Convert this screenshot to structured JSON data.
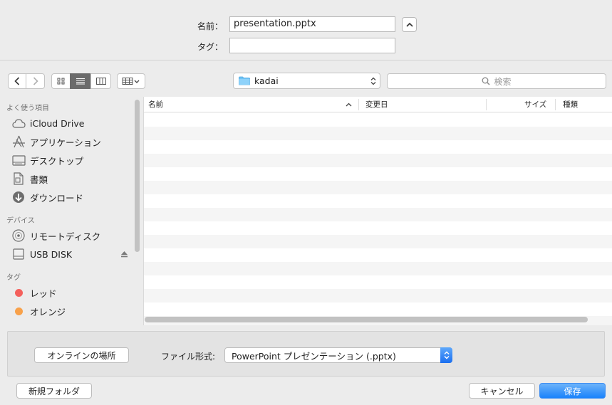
{
  "save_form": {
    "name_label": "名前：",
    "name_value": "presentation.pptx",
    "tags_label": "タグ：",
    "tags_value": ""
  },
  "toolbar": {
    "location": "kadai",
    "search_placeholder": "検索"
  },
  "sidebar": {
    "favorites_header": "よく使う項目",
    "favorites": [
      {
        "label": "iCloud Drive",
        "icon": "cloud-icon"
      },
      {
        "label": "アプリケーション",
        "icon": "applications-icon"
      },
      {
        "label": "デスクトップ",
        "icon": "desktop-icon"
      },
      {
        "label": "書類",
        "icon": "documents-icon"
      },
      {
        "label": "ダウンロード",
        "icon": "download-icon"
      }
    ],
    "devices_header": "デバイス",
    "devices": [
      {
        "label": "リモートディスク",
        "icon": "disc-icon"
      },
      {
        "label": "USB DISK",
        "icon": "drive-icon"
      }
    ],
    "tags_header": "タグ",
    "tags": [
      {
        "label": "レッド",
        "color": "#f4605c"
      },
      {
        "label": "オレンジ",
        "color": "#f8a14a"
      }
    ]
  },
  "file_list": {
    "columns": [
      "名前",
      "変更日",
      "サイズ",
      "種類"
    ],
    "rows": []
  },
  "accessory": {
    "online_button": "オンラインの場所",
    "format_label": "ファイル形式:",
    "format_value": "PowerPoint プレゼンテーション (.pptx)"
  },
  "footer": {
    "new_folder": "新規フォルダ",
    "cancel": "キャンセル",
    "save": "保存"
  },
  "colors": {
    "accent": "#1a82fb",
    "window_bg": "#ececec"
  }
}
